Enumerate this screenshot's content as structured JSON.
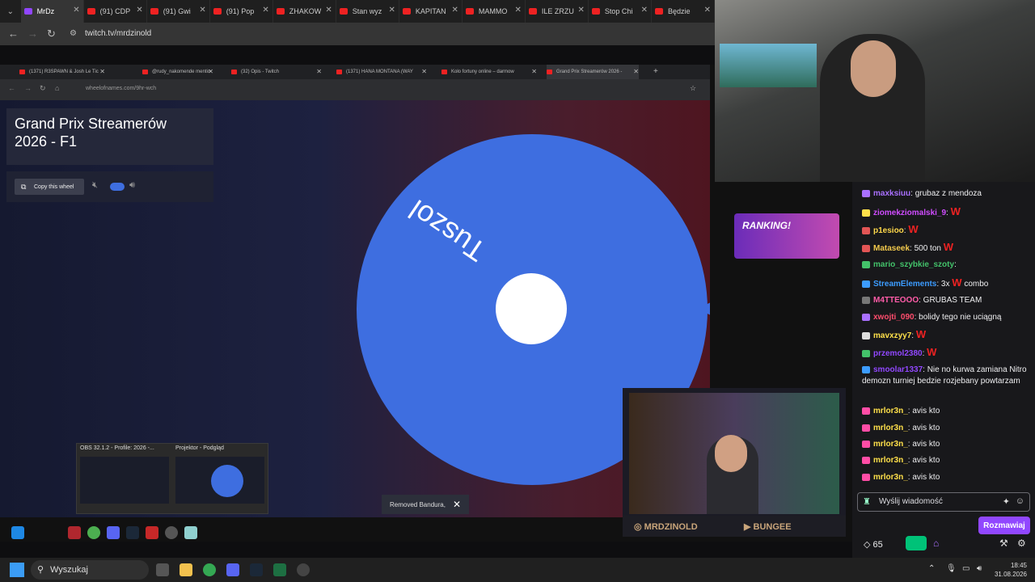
{
  "outer_browser": {
    "tabs": [
      {
        "label": "MrDz",
        "active": true
      },
      {
        "label": "(91) CDP"
      },
      {
        "label": "(91) Gwi"
      },
      {
        "label": "(91) Pop"
      },
      {
        "label": "ZHAKOW"
      },
      {
        "label": "Stan wyz"
      },
      {
        "label": "KAPITAN"
      },
      {
        "label": "MAMMO"
      },
      {
        "label": "ILE ZRZU"
      },
      {
        "label": "Stop Chi"
      },
      {
        "label": "Będzie"
      }
    ],
    "url": "twitch.tv/mrdzinold"
  },
  "inner_browser": {
    "tabs": [
      "(1371) R3SPAWN & Josh Le Tic",
      "@rudy_nakomende mentio",
      "(32) Opis - Twitch",
      "(1371) HANA MONTANA (WAY",
      "Koło fortuny online – darmow",
      "Grand Prix Streamerów 2026 -"
    ],
    "url": "wheelofnames.com/9hr-wch"
  },
  "wheel_page": {
    "title": "Grand Prix Streamerów 2026 - F1",
    "copy_button": "Copy this wheel",
    "wheel_entry": "Tuszol",
    "toast": "Removed Bandura,"
  },
  "thumbnails": [
    {
      "label": "OBS 32.1.2 - Profile: 2026 -..."
    },
    {
      "label": "Projektor - Podgląd"
    }
  ],
  "overlay": {
    "ranking": "RANKING!",
    "cam_label_left": "MRDZINOLD",
    "cam_label_right": "BUNGEE"
  },
  "chat": {
    "messages": [
      {
        "user": "maxksiuu",
        "color": "#a970ff",
        "text": ": grubaz z mendoza",
        "w": false
      },
      {
        "user": "ziomekziomalski_9",
        "color": "#d04cff",
        "text": ":",
        "w": true
      },
      {
        "user": "p1esioo",
        "color": "#ffd84a",
        "text": ":",
        "w": true
      },
      {
        "user": "Mataseek",
        "color": "#f2c94c",
        "text": ": 500 ton",
        "w": true
      },
      {
        "user": "mario_szybkie_szoty",
        "color": "#43c26a",
        "text": ":",
        "w": false
      },
      {
        "user": "StreamElements",
        "color": "#3c9cff",
        "text": ": 3x",
        "w": true,
        "after": "combo"
      },
      {
        "user": "M4TTEOOO",
        "color": "#ff5ca8",
        "text": ": GRUBAS TEAM",
        "w": false
      },
      {
        "user": "xwojti_090",
        "color": "#ff4d6d",
        "text": ": bolidy tego nie uciągną",
        "w": false
      },
      {
        "user": "mavxzyy7",
        "color": "#ffe04a",
        "text": ":",
        "w": true
      },
      {
        "user": "przemol2380",
        "color": "#9147ff",
        "text": ":",
        "w": true
      },
      {
        "user": "smoolar1337",
        "color": "#9147ff",
        "text": ": Nie no kurwa zamiana Nitro demozn turniej bedzie rozjebany powtarzam",
        "w": false
      },
      {
        "user": "mrlor3n_",
        "color": "#ffe04a",
        "text": ": avis kto",
        "w": false
      },
      {
        "user": "mrlor3n_",
        "color": "#ffe04a",
        "text": ": avis kto",
        "w": false
      },
      {
        "user": "mrlor3n_",
        "color": "#ffe04a",
        "text": ": avis kto",
        "w": false
      },
      {
        "user": "mrlor3n_",
        "color": "#ffe04a",
        "text": ": avis kto",
        "w": false
      },
      {
        "user": "mrlor3n_",
        "color": "#ffe04a",
        "text": ": avis kto",
        "w": false
      }
    ],
    "w_text": "W",
    "input_placeholder": "Wyślij wiadomość",
    "send_label": "Rozmawiaj",
    "points": "65"
  },
  "taskbar": {
    "search": "Wyszukaj",
    "time": "18:45",
    "date": "31.08.2026"
  }
}
